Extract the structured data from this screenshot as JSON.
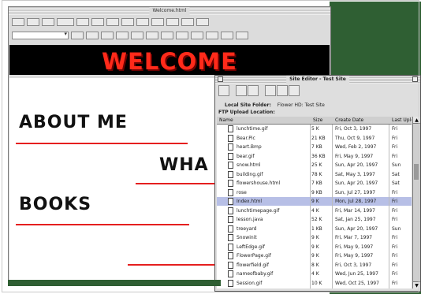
{
  "editor": {
    "title": "Welcome.html",
    "welcome_text": "WELCOME",
    "headings": {
      "about": "ABOUT ME",
      "what": "WHA",
      "books": "BOOKS"
    }
  },
  "site_editor": {
    "title": "Site Editor - Test Site",
    "local_site_folder_label": "Local Site Folder:",
    "local_site_folder_value": "Flower HD: Test Site",
    "ftp_label": "FTP Upload Location:",
    "columns": [
      "Name",
      "Size",
      "Create Date",
      "Last Upload"
    ],
    "files": [
      {
        "name": "lunchtime.gif",
        "size": "5 K",
        "date": "Fri, Oct 3, 1997",
        "last": "Fri"
      },
      {
        "name": "Bear.Pic",
        "size": "21 KB",
        "date": "Thu, Oct 9, 1997",
        "last": "Fri"
      },
      {
        "name": "heart.Bmp",
        "size": "7 KB",
        "date": "Wed, Feb 2, 1997",
        "last": "Fri"
      },
      {
        "name": "bear.gif",
        "size": "36 KB",
        "date": "Fri, May 9, 1997",
        "last": "Fri"
      },
      {
        "name": "snow.html",
        "size": "25 K",
        "date": "Sun, Apr 20, 1997",
        "last": "Sun"
      },
      {
        "name": "building.gif",
        "size": "78 K",
        "date": "Sat, May 3, 1997",
        "last": "Sat"
      },
      {
        "name": "flowershouse.html",
        "size": "7 KB",
        "date": "Sun, Apr 20, 1997",
        "last": "Sat"
      },
      {
        "name": "rose",
        "size": "9 KB",
        "date": "Sun, Jul 27, 1997",
        "last": "Fri"
      },
      {
        "name": "Index.html",
        "size": "9 K",
        "date": "Mon, Jul 28, 1997",
        "last": "Fri"
      },
      {
        "name": "lunchtimepage.gif",
        "size": "4 K",
        "date": "Fri, Mar 14, 1997",
        "last": "Fri"
      },
      {
        "name": "lesson.java",
        "size": "52 K",
        "date": "Sat, Jan 25, 1997",
        "last": "Fri"
      },
      {
        "name": "treeyard",
        "size": "1 KB",
        "date": "Sun, Apr 20, 1997",
        "last": "Sun"
      },
      {
        "name": "Snowinit",
        "size": "9 K",
        "date": "Fri, Mar 7, 1997",
        "last": "Fri"
      },
      {
        "name": "LeftEdge.gif",
        "size": "9 K",
        "date": "Fri, May 9, 1997",
        "last": "Fri"
      },
      {
        "name": "FlowerPage.gif",
        "size": "9 K",
        "date": "Fri, May 9, 1997",
        "last": "Fri"
      },
      {
        "name": "flowerfield.gif",
        "size": "8 K",
        "date": "Fri, Oct 3, 1997",
        "last": "Fri"
      },
      {
        "name": "nameofbaby.gif",
        "size": "4 K",
        "date": "Wed, Jun 25, 1997",
        "last": "Fri"
      },
      {
        "name": "Session.gif",
        "size": "10 K",
        "date": "Wed, Oct 25, 1997",
        "last": "Fri"
      }
    ],
    "selected_index": 8
  }
}
